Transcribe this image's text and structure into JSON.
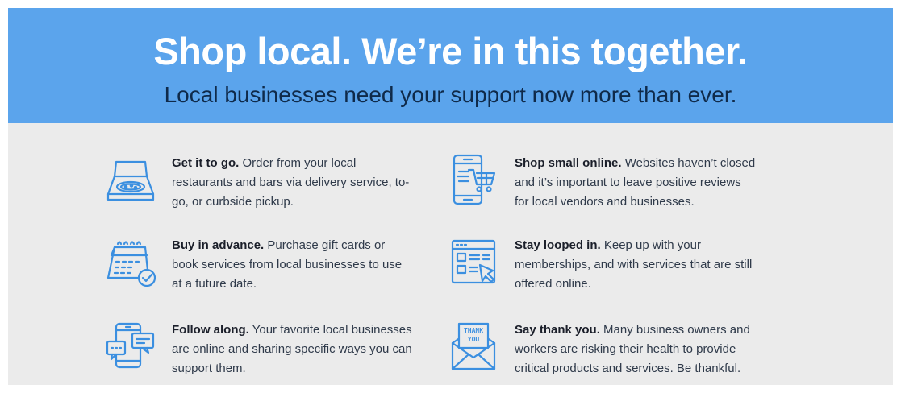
{
  "banner": {
    "headline": "Shop local. We’re in this together.",
    "subheadline": "Local businesses need your support now more than ever."
  },
  "colors": {
    "banner_blue": "#5ba4ec",
    "icon_blue": "#3b8fe0",
    "background_gray": "#ebebeb",
    "heading_navy": "#0f2a4a"
  },
  "tips": [
    {
      "icon": "pizza-box-icon",
      "title": "Get it to go.",
      "body": "Order from your local restaurants and bars via delivery service, to-go, or curbside pickup."
    },
    {
      "icon": "calendar-check-icon",
      "title": "Buy in advance.",
      "body": "Purchase gift cards or book services from local businesses to use at a future date."
    },
    {
      "icon": "phone-chat-icon",
      "title": "Follow along.",
      "body": "Your favorite local businesses are online and sharing specific ways you can support them."
    },
    {
      "icon": "phone-cart-icon",
      "title": "Shop small online.",
      "body": "Websites haven’t closed and it’s important to leave positive reviews for local vendors and businesses."
    },
    {
      "icon": "browser-cursor-icon",
      "title": "Stay looped in.",
      "body": "Keep up with your memberships, and with services that are still offered online."
    },
    {
      "icon": "thank-you-envelope-icon",
      "title": "Say thank you.",
      "body": "Many business owners and workers are risking their health to provide critical products and services. Be thankful."
    }
  ]
}
